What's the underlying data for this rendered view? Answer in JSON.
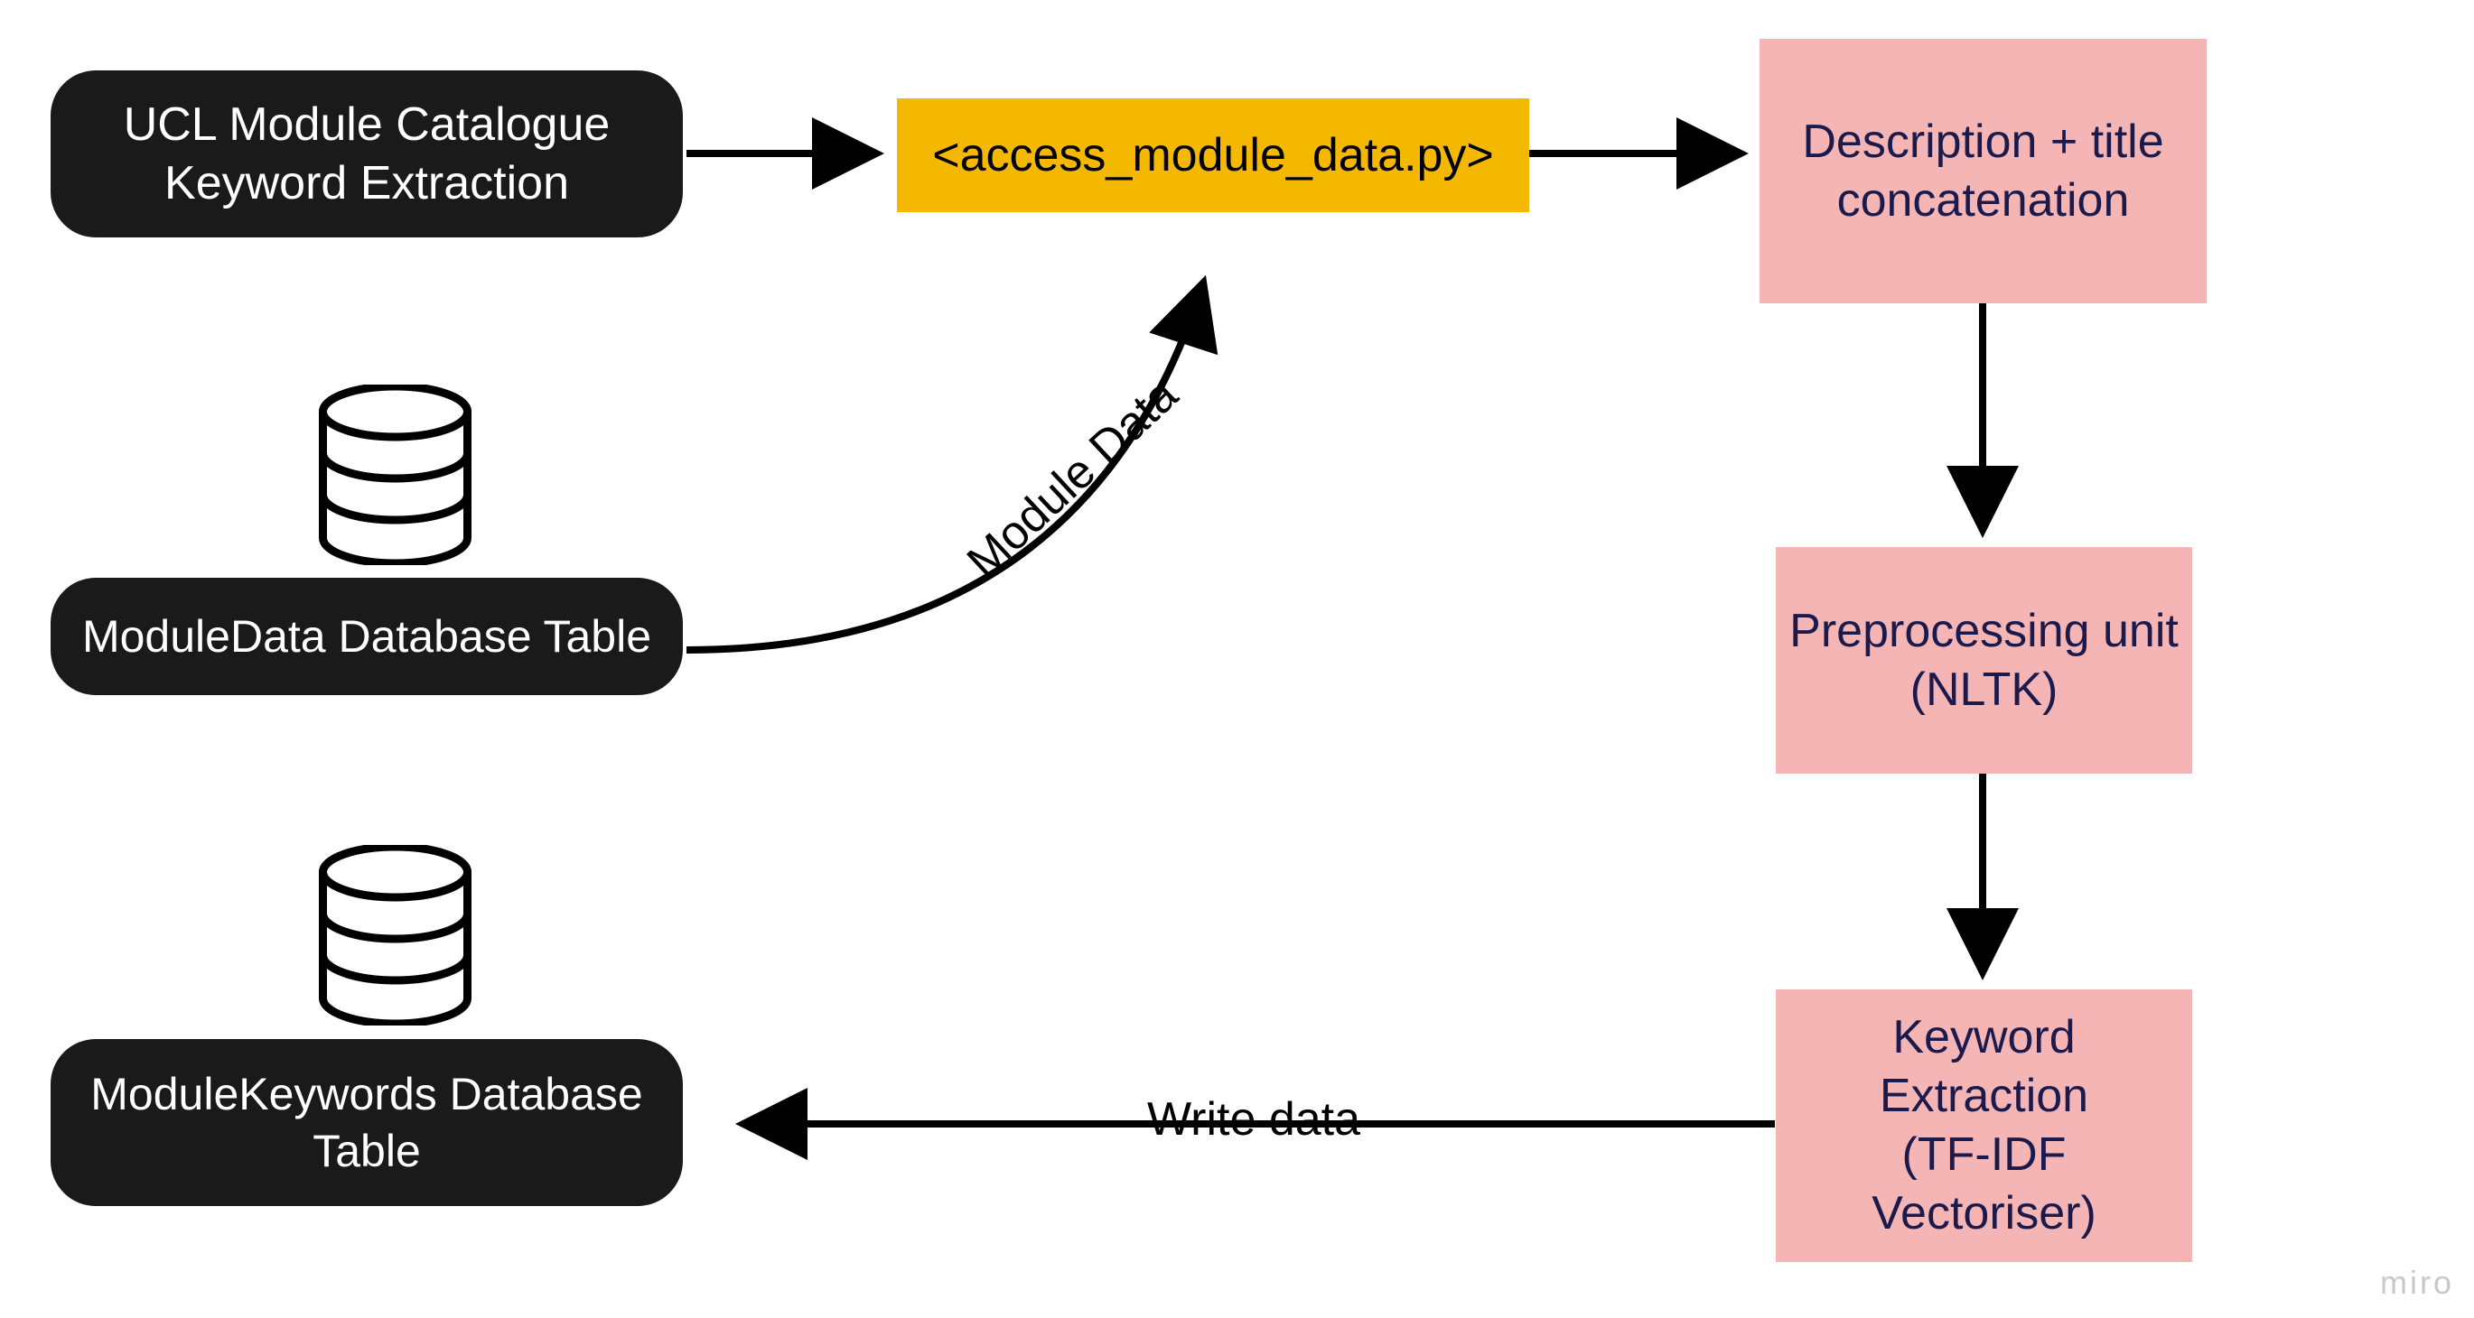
{
  "nodes": {
    "start": {
      "line1": "UCL Module Catalogue",
      "line2": "Keyword Extraction"
    },
    "script": "<access_module_data.py>",
    "concat": {
      "line1": "Description + title",
      "line2": "concatenation"
    },
    "preprocess": {
      "line1": "Preprocessing unit",
      "line2": "(NLTK)"
    },
    "keyword": {
      "line1": "Keyword",
      "line2": "Extraction",
      "line3": "(TF-IDF",
      "line4": "Vectoriser)"
    },
    "dbModuleData": "ModuleData Database Table",
    "dbModuleKeywords": {
      "line1": "ModuleKeywords Database",
      "line2": "Table"
    }
  },
  "edges": {
    "moduleData": "Module Data",
    "writeData": "Write data"
  },
  "watermark": "miro"
}
